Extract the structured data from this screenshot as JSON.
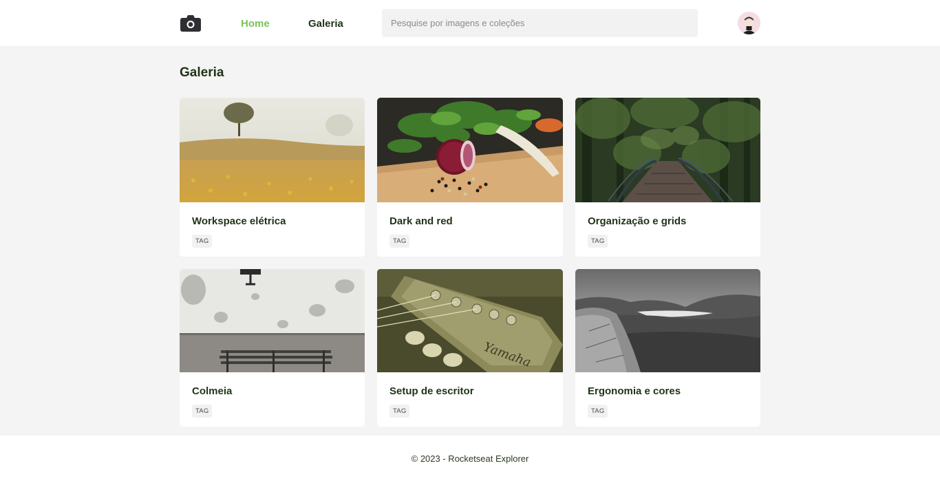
{
  "header": {
    "logo_icon": "camera-icon",
    "nav": {
      "home": "Home",
      "gallery": "Galeria"
    },
    "search": {
      "placeholder": "Pesquise por imagens e coleções",
      "value": ""
    },
    "avatar_icon": "user-avatar"
  },
  "colors": {
    "accent": "#7ac35a",
    "dark_green": "#1f3317",
    "page_bg": "#f4f4f4"
  },
  "main": {
    "title": "Galeria",
    "cards": [
      {
        "title": "Workspace elétrica",
        "tag": "TAG",
        "image": "wheat-field-image"
      },
      {
        "title": "Dark and red",
        "tag": "TAG",
        "image": "onion-vegetables-image"
      },
      {
        "title": "Organização e grids",
        "tag": "TAG",
        "image": "forest-bridge-image"
      },
      {
        "title": "Colmeia",
        "tag": "TAG",
        "image": "bench-wall-image"
      },
      {
        "title": "Setup de escritor",
        "tag": "TAG",
        "image": "guitar-headstock-image"
      },
      {
        "title": "Ergonomia e cores",
        "tag": "TAG",
        "image": "mountain-valley-image"
      }
    ]
  },
  "footer": {
    "copyright": "© 2023 - Rocketseat Explorer"
  }
}
